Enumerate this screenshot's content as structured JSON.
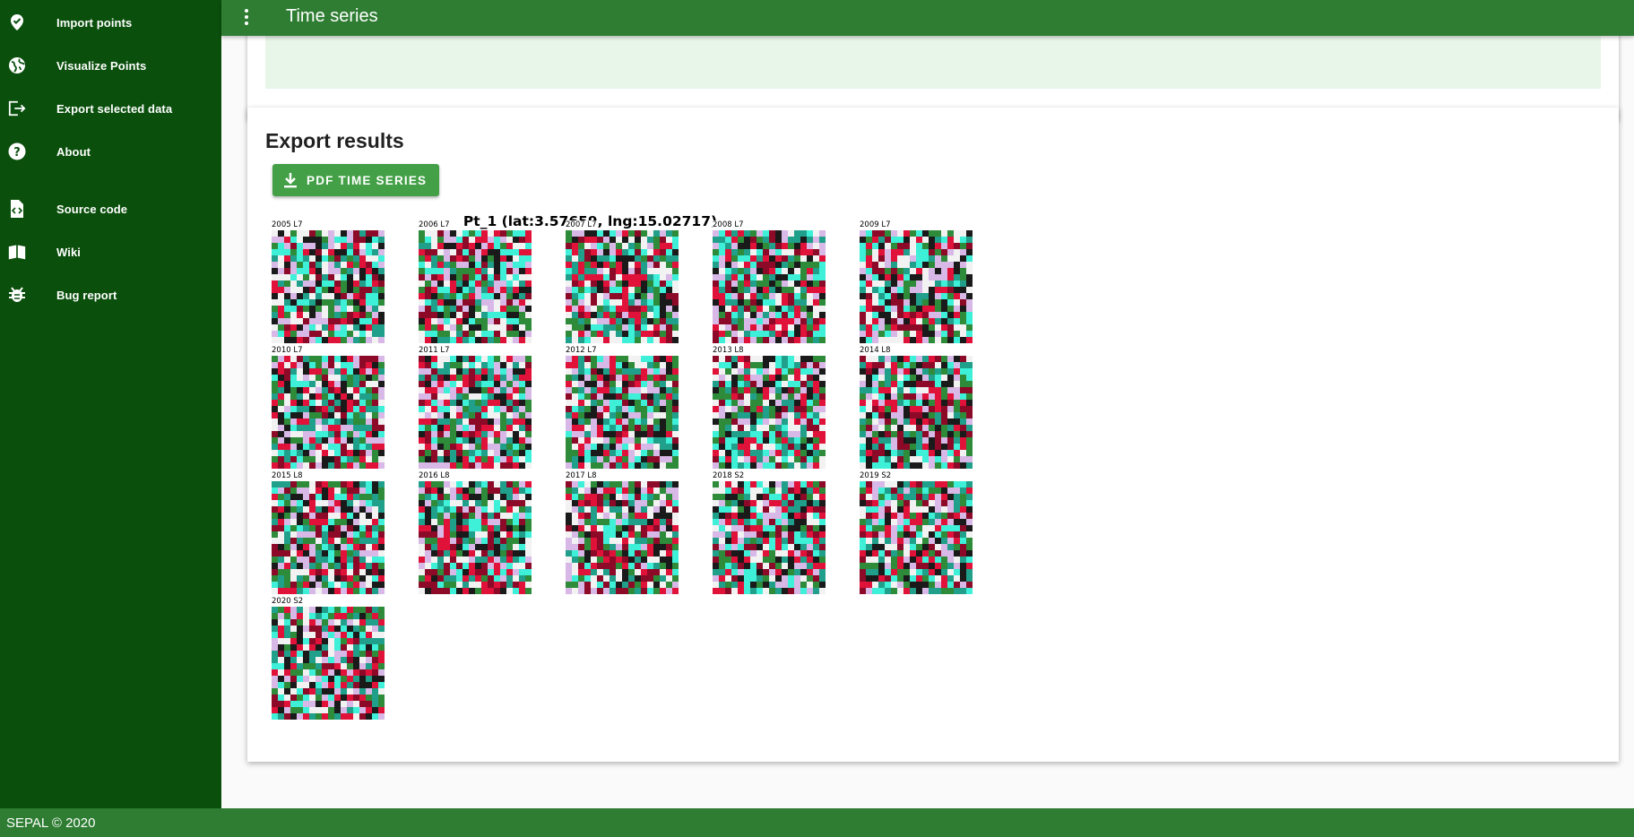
{
  "app": {
    "title": "Time series"
  },
  "sidebar": {
    "items": [
      {
        "label": "Import points",
        "icon": "map-marker-check-icon"
      },
      {
        "label": "Visualize Points",
        "icon": "globe-icon"
      },
      {
        "label": "Export selected data",
        "icon": "export-icon"
      },
      {
        "label": "About",
        "icon": "help-circle-icon"
      },
      {
        "label": "Source code",
        "icon": "file-code-icon"
      },
      {
        "label": "Wiki",
        "icon": "book-open-icon"
      },
      {
        "label": "Bug report",
        "icon": "bug-icon"
      }
    ]
  },
  "export": {
    "title": "Export results",
    "button_label": "PDF TIME SERIES",
    "button_icon": "download-icon"
  },
  "time_series": {
    "title": "Pt_1 (lat:3.57659, lng:15.02717)",
    "thumbnails": [
      {
        "label": "2005 L7"
      },
      {
        "label": "2006 L7"
      },
      {
        "label": "2007 L7"
      },
      {
        "label": "2008 L7"
      },
      {
        "label": "2009 L7"
      },
      {
        "label": "2010 L7"
      },
      {
        "label": "2011 L7"
      },
      {
        "label": "2012 L7"
      },
      {
        "label": "2013 L8"
      },
      {
        "label": "2014 L8"
      },
      {
        "label": "2015 L8"
      },
      {
        "label": "2016 L8"
      },
      {
        "label": "2017 L8"
      },
      {
        "label": "2018 S2"
      },
      {
        "label": "2019 S2"
      },
      {
        "label": "2020 S2"
      }
    ]
  },
  "footer": {
    "text": "SEPAL © 2020"
  },
  "colors": {
    "sidebar_bg": "#0a4f0c",
    "topbar_bg": "#2e7d32",
    "button_bg": "#43a047",
    "strip_bg": "#e8f5e9",
    "imagery_palette": [
      "#e0123a",
      "#8c0a28",
      "#1a1a1a",
      "#3ef0d8",
      "#20a08a",
      "#f2f2f2",
      "#d8b8e6",
      "#2e8b3a"
    ]
  }
}
